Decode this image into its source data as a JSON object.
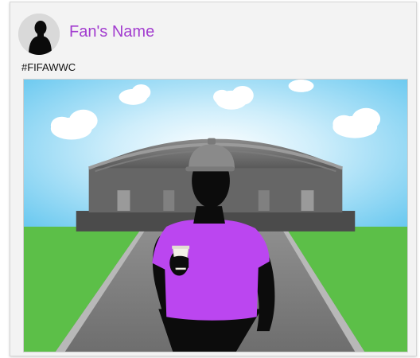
{
  "post": {
    "author_name": "Fan's Name",
    "caption": "#FIFAWWC",
    "avatar_icon": "person-silhouette-icon",
    "photo_subject": "fan-in-front-of-stadium-illustration"
  },
  "colors": {
    "name_accent": "#a23ccf",
    "shirt": "#bb46f0",
    "sky": "#72cdf2",
    "grass": "#5cbf48",
    "stadium": "#5d5d5d"
  }
}
